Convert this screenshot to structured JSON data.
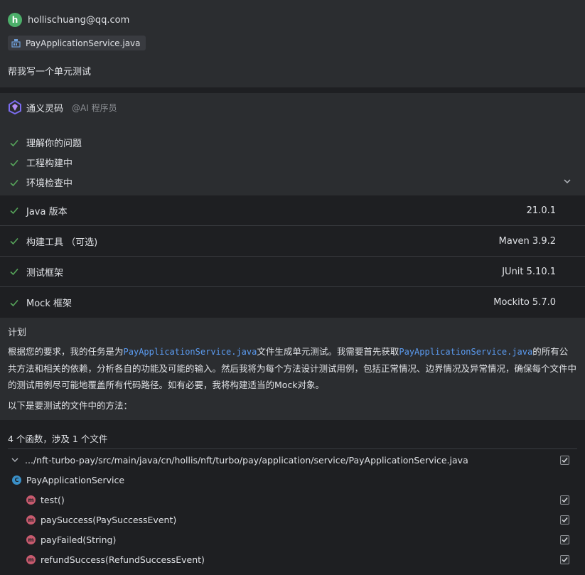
{
  "user": {
    "avatar_letter": "h",
    "email": "hollischuang@qq.com",
    "attached_file": "PayApplicationService.java",
    "message": "帮我写一个单元测试"
  },
  "assistant": {
    "name": "通义灵码",
    "role": "@AI 程序员",
    "steps": [
      {
        "label": "理解你的问题"
      },
      {
        "label": "工程构建中"
      },
      {
        "label": "环境检查中"
      }
    ],
    "environment": [
      {
        "label": "Java 版本",
        "value": "21.0.1"
      },
      {
        "label": "构建工具 （可选)",
        "value": "Maven 3.9.2"
      },
      {
        "label": "测试框架",
        "value": "JUnit 5.10.1"
      },
      {
        "label": "Mock 框架",
        "value": "Mockito 5.7.0"
      }
    ]
  },
  "plan": {
    "title": "计划",
    "text_1": "根据您的要求，我的任务是为",
    "code_1": "PayApplicationService.java",
    "text_2": "文件生成单元测试。我需要首先获取",
    "code_2": "PayApplicationService.java",
    "text_3": "的所有公共方法和相关的依赖，分析各自的功能及可能的输入。然后我将为每个方法设计测试用例，包括正常情况、边界情况及异常情况，确保每个文件中的测试用例尽可能地覆盖所有代码路径。如有必要，我将构建适当的Mock对象。",
    "subtitle": "以下是要测试的文件中的方法："
  },
  "functions": {
    "summary": "4 个函数，涉及 1 个文件",
    "file_path": ".../nft-turbo-pay/src/main/java/cn/hollis/nft/turbo/pay/application/service/PayApplicationService.java",
    "class_badge": "C",
    "class_name": "PayApplicationService",
    "method_badge": "m",
    "methods": [
      {
        "name": "test()"
      },
      {
        "name": "paySuccess(PaySuccessEvent)"
      },
      {
        "name": "payFailed(String)"
      },
      {
        "name": "refundSuccess(RefundSuccessEvent)"
      }
    ]
  },
  "colors": {
    "background": "#1e1f22",
    "panel": "#2b2d30",
    "check": "#57a65b",
    "link": "#5b9bf0",
    "avatar": "#4caf6a",
    "class_badge": "#3a8fc7",
    "method_badge": "#c75a6e"
  },
  "icons": {
    "avatar": "user-avatar",
    "file": "java-file-icon",
    "logo": "tongyi-lingma-logo",
    "check": "check-icon",
    "expand": "chevron-down-icon",
    "tree_expand": "chevron-down-icon",
    "checkbox": "checkbox-checked-icon"
  }
}
